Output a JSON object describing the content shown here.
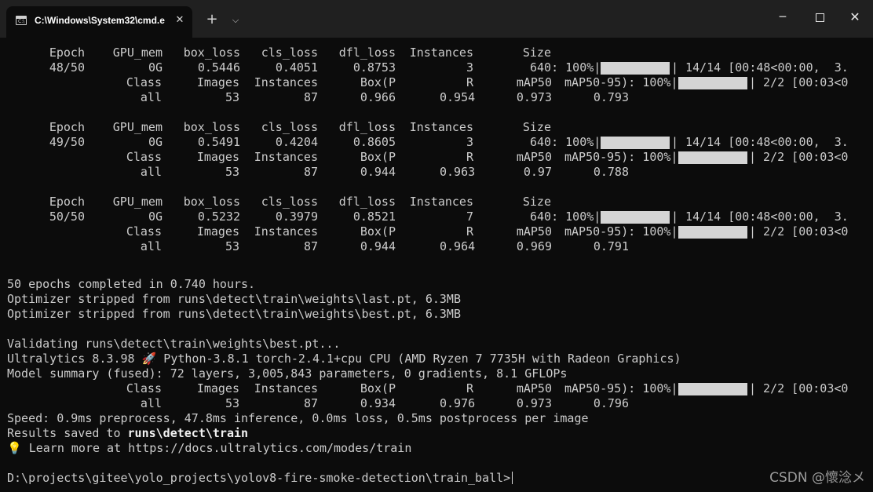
{
  "window": {
    "tab_title": "C:\\Windows\\System32\\cmd.e",
    "tab_close": "✕",
    "new_tab": "+",
    "dropdown": "⌵",
    "minimize": "─",
    "close": "✕"
  },
  "headers": {
    "epoch": "Epoch",
    "gpu_mem": "GPU_mem",
    "box_loss": "box_loss",
    "cls_loss": "cls_loss",
    "dfl_loss": "dfl_loss",
    "instances": "Instances",
    "size": "Size"
  },
  "val_headers": {
    "class": "Class",
    "images": "Images",
    "instances": "Instances",
    "boxp": "Box(P",
    "r": "R",
    "map50": "mAP50",
    "map50_95": "mAP50-95): 100%|",
    "end": "| 2/2 [00:03<0"
  },
  "epochs": [
    {
      "epoch": "48/50",
      "gpu_mem": "0G",
      "box_loss": "0.5446",
      "cls_loss": "0.4051",
      "dfl_loss": "0.8753",
      "instances": "3",
      "size": "640: 100%|",
      "progress": 1.0,
      "tail": "| 14/14 [00:48<00:00,  3.",
      "val": {
        "cls": "all",
        "images": "53",
        "instances": "87",
        "boxp": "0.966",
        "r": "0.954",
        "map50": "0.973",
        "map50_95": "0.793"
      }
    },
    {
      "epoch": "49/50",
      "gpu_mem": "0G",
      "box_loss": "0.5491",
      "cls_loss": "0.4204",
      "dfl_loss": "0.8605",
      "instances": "3",
      "size": "640: 100%|",
      "progress": 1.0,
      "tail": "| 14/14 [00:48<00:00,  3.",
      "val": {
        "cls": "all",
        "images": "53",
        "instances": "87",
        "boxp": "0.944",
        "r": "0.963",
        "map50": "0.97",
        "map50_95": "0.788"
      }
    },
    {
      "epoch": "50/50",
      "gpu_mem": "0G",
      "box_loss": "0.5232",
      "cls_loss": "0.3979",
      "dfl_loss": "0.8521",
      "instances": "7",
      "size": "640: 100%|",
      "progress": 1.0,
      "tail": "| 14/14 [00:48<00:00,  3.",
      "val": {
        "cls": "all",
        "images": "53",
        "instances": "87",
        "boxp": "0.944",
        "r": "0.964",
        "map50": "0.969",
        "map50_95": "0.791"
      }
    }
  ],
  "summary": {
    "completed": "50 epochs completed in 0.740 hours.",
    "strip_last": "Optimizer stripped from runs\\detect\\train\\weights\\last.pt, 6.3MB",
    "strip_best": "Optimizer stripped from runs\\detect\\train\\weights\\best.pt, 6.3MB",
    "validating": "Validating runs\\detect\\train\\weights\\best.pt...",
    "ultralytics": "Ultralytics 8.3.98 🚀 Python-3.8.1 torch-2.4.1+cpu CPU (AMD Ryzen 7 7735H with Radeon Graphics)",
    "model_summary": "Model summary (fused): 72 layers, 3,005,843 parameters, 0 gradients, 8.1 GFLOPs",
    "final_val": {
      "cls": "all",
      "images": "53",
      "instances": "87",
      "boxp": "0.934",
      "r": "0.976",
      "map50": "0.973",
      "map50_95": "0.796"
    },
    "speed": "Speed: 0.9ms preprocess, 47.8ms inference, 0.0ms loss, 0.5ms postprocess per image",
    "results_prefix": "Results saved to ",
    "results_path": "runs\\detect\\train",
    "learn_more": "💡 Learn more at https://docs.ultralytics.com/modes/train",
    "prompt": "D:\\projects\\gitee\\yolo_projects\\yolov8-fire-smoke-detection\\train_ball>"
  },
  "watermark": "CSDN @懷淰メ"
}
